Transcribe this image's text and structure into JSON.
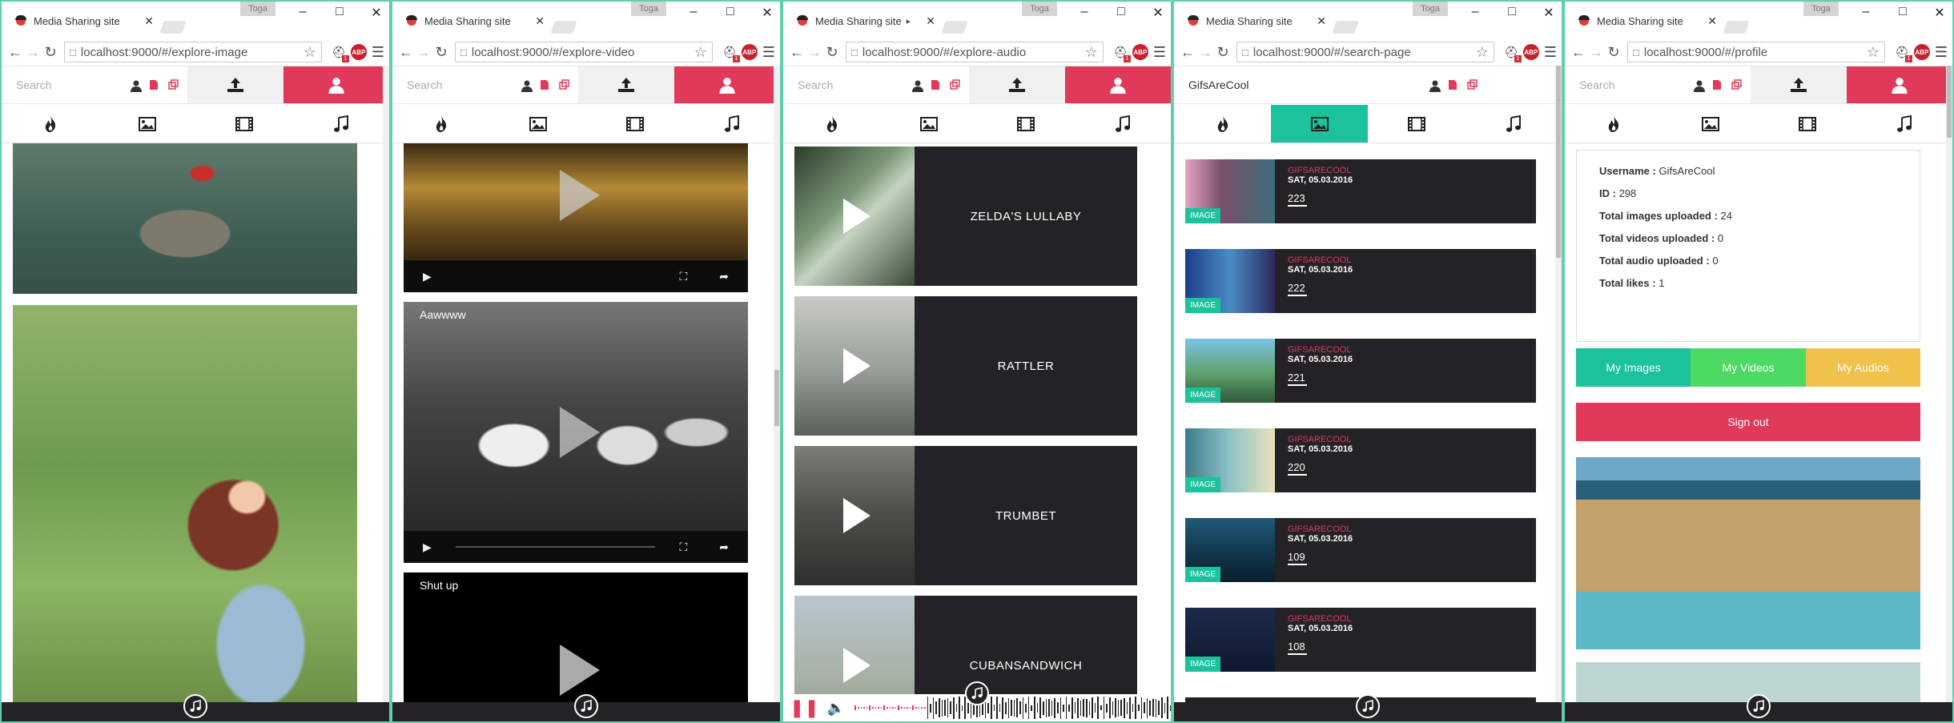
{
  "windows": [
    {
      "tab_title": "Media Sharing site",
      "url": "localhost:9000/#/explore-image",
      "search_placeholder": "Search",
      "search_value": "",
      "active_category": -1
    },
    {
      "tab_title": "Media Sharing site",
      "url": "localhost:9000/#/explore-video",
      "search_placeholder": "Search",
      "search_value": "",
      "active_category": -1,
      "videos": [
        "",
        "Aawwww",
        "Shut up"
      ]
    },
    {
      "tab_title": "Media Sharing site",
      "url": "localhost:9000/#/explore-audio",
      "search_placeholder": "Search",
      "search_value": "",
      "active_category": -1,
      "audios": [
        "ZELDA'S LULLABY",
        "RATTLER",
        "TRUMBET",
        "CUBANSANDWICH"
      ]
    },
    {
      "tab_title": "Media Sharing site",
      "url": "localhost:9000/#/search-page",
      "search_placeholder": "Search",
      "search_value": "GifsAreCool",
      "active_category": 1,
      "results": [
        {
          "user": "GIFSARECOOL",
          "date": "SAT, 05.03.2016",
          "id": "223",
          "type": "IMAGE"
        },
        {
          "user": "GIFSARECOOL",
          "date": "SAT, 05.03.2016",
          "id": "222",
          "type": "IMAGE"
        },
        {
          "user": "GIFSARECOOL",
          "date": "SAT, 05.03.2016",
          "id": "221",
          "type": "IMAGE"
        },
        {
          "user": "GIFSARECOOL",
          "date": "SAT, 05.03.2016",
          "id": "220",
          "type": "IMAGE"
        },
        {
          "user": "GIFSARECOOL",
          "date": "SAT, 05.03.2016",
          "id": "109",
          "type": "IMAGE"
        },
        {
          "user": "GIFSARECOOL",
          "date": "SAT, 05.03.2016",
          "id": "108",
          "type": "IMAGE"
        }
      ]
    },
    {
      "tab_title": "Media Sharing site",
      "url": "localhost:9000/#/profile",
      "search_placeholder": "Search",
      "search_value": "",
      "active_category": -1,
      "profile": {
        "username_label": "Username :",
        "username": "GifsAreCool",
        "id_label": "ID :",
        "id": "298",
        "images_label": "Total images uploaded :",
        "images": "24",
        "videos_label": "Total videos uploaded :",
        "videos": "0",
        "audio_label": "Total audio uploaded :",
        "audio": "0",
        "likes_label": "Total likes :",
        "likes": "1",
        "btn_images": "My Images",
        "btn_videos": "My Videos",
        "btn_audios": "My Audios",
        "signout": "Sign out"
      }
    }
  ],
  "browser": {
    "toga": "Toga",
    "abp": "ABP",
    "ext_badge": "1"
  },
  "colors": {
    "accent_pink": "#e0395a",
    "accent_teal": "#1bc29b",
    "accent_green": "#4cd964",
    "accent_yellow": "#f0c24b",
    "dark": "#242227",
    "window_border": "#5fcfad"
  }
}
